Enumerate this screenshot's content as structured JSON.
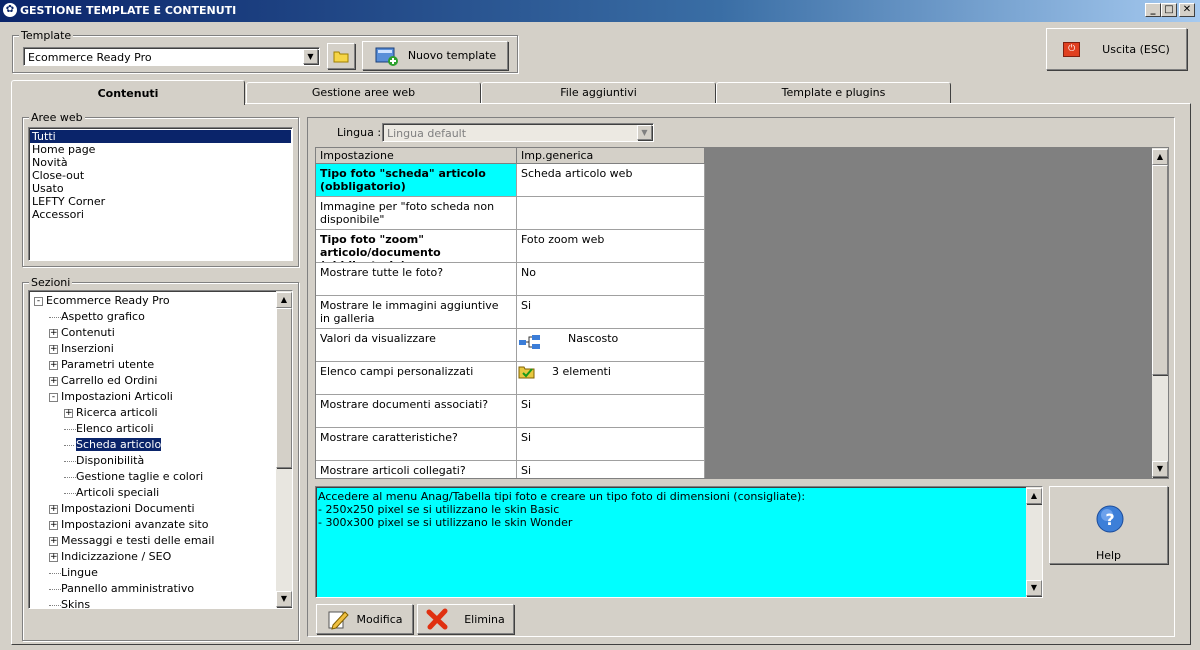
{
  "window": {
    "title": "GESTIONE TEMPLATE E CONTENUTI"
  },
  "template": {
    "group_label": "Template",
    "selected": "Ecommerce Ready Pro",
    "new_button": "Nuovo template"
  },
  "exit_button": "Uscita (ESC)",
  "tabs": [
    "Contenuti",
    "Gestione aree web",
    "File aggiuntivi",
    "Template e plugins"
  ],
  "aree_web": {
    "label": "Aree web",
    "items": [
      "Tutti",
      "Home page",
      "Novità",
      "Close-out",
      "Usato",
      "LEFTY Corner",
      "Accessori"
    ],
    "selected_index": 0
  },
  "sezioni": {
    "label": "Sezioni",
    "tree": [
      {
        "label": "Ecommerce Ready Pro",
        "level": 0,
        "exp": "-"
      },
      {
        "label": "Aspetto grafico",
        "level": 1,
        "exp": ""
      },
      {
        "label": "Contenuti",
        "level": 1,
        "exp": "+"
      },
      {
        "label": "Inserzioni",
        "level": 1,
        "exp": "+"
      },
      {
        "label": "Parametri utente",
        "level": 1,
        "exp": "+"
      },
      {
        "label": "Carrello ed Ordini",
        "level": 1,
        "exp": "+"
      },
      {
        "label": "Impostazioni Articoli",
        "level": 1,
        "exp": "-"
      },
      {
        "label": "Ricerca articoli",
        "level": 2,
        "exp": "+"
      },
      {
        "label": "Elenco articoli",
        "level": 2,
        "exp": ""
      },
      {
        "label": "Scheda articolo",
        "level": 2,
        "exp": "",
        "selected": true
      },
      {
        "label": "Disponibilità",
        "level": 2,
        "exp": ""
      },
      {
        "label": "Gestione taglie e colori",
        "level": 2,
        "exp": ""
      },
      {
        "label": "Articoli speciali",
        "level": 2,
        "exp": ""
      },
      {
        "label": "Impostazioni Documenti",
        "level": 1,
        "exp": "+"
      },
      {
        "label": "Impostazioni avanzate sito",
        "level": 1,
        "exp": "+"
      },
      {
        "label": "Messaggi e testi delle email",
        "level": 1,
        "exp": "+"
      },
      {
        "label": "Indicizzazione / SEO",
        "level": 1,
        "exp": "+"
      },
      {
        "label": "Lingue",
        "level": 1,
        "exp": ""
      },
      {
        "label": "Pannello amministrativo",
        "level": 1,
        "exp": ""
      },
      {
        "label": "Skins",
        "level": 1,
        "exp": ""
      }
    ]
  },
  "lingua": {
    "label": "Lingua :",
    "value": "Lingua default"
  },
  "grid": {
    "headers": [
      "Impostazione",
      "Imp.generica"
    ],
    "rows": [
      {
        "name": "Tipo foto \"scheda\" articolo (obbligatorio)",
        "value": "Scheda articolo web",
        "bold": true,
        "highlight": true,
        "icon": ""
      },
      {
        "name": "Immagine per \"foto scheda non disponibile\"",
        "value": "",
        "bold": false,
        "highlight": false,
        "icon": ""
      },
      {
        "name": "Tipo foto \"zoom\" articolo/documento (obbligatorio)",
        "value": "Foto zoom web",
        "bold": true,
        "highlight": false,
        "icon": ""
      },
      {
        "name": "Mostrare tutte le foto?",
        "value": "No",
        "bold": false,
        "highlight": false,
        "icon": ""
      },
      {
        "name": "Mostrare le immagini aggiuntive in galleria",
        "value": "Si",
        "bold": false,
        "highlight": false,
        "icon": ""
      },
      {
        "name": "Valori da visualizzare",
        "value": "Nascosto",
        "bold": false,
        "highlight": false,
        "icon": "tree"
      },
      {
        "name": "Elenco campi personalizzati",
        "value": "3 elementi",
        "bold": false,
        "highlight": false,
        "icon": "folder"
      },
      {
        "name": "Mostrare documenti associati?",
        "value": "Si",
        "bold": false,
        "highlight": false,
        "icon": ""
      },
      {
        "name": "Mostrare caratteristiche?",
        "value": "Si",
        "bold": false,
        "highlight": false,
        "icon": ""
      },
      {
        "name": "Mostrare articoli collegati?",
        "value": "Si",
        "bold": false,
        "highlight": false,
        "icon": ""
      }
    ]
  },
  "description": {
    "lines": [
      "Accedere al menu Anag/Tabella tipi foto e creare un tipo foto di dimensioni (consigliate):",
      "- 250x250 pixel se si utilizzano le skin Basic",
      "- 300x300 pixel se si utilizzano le skin Wonder"
    ]
  },
  "buttons": {
    "help": "Help",
    "modifica": "Modifica",
    "elimina": "Elimina"
  },
  "colors": {
    "highlight": "#00ffff",
    "selection": "#0a246a",
    "titlebar": "#0a246a"
  }
}
